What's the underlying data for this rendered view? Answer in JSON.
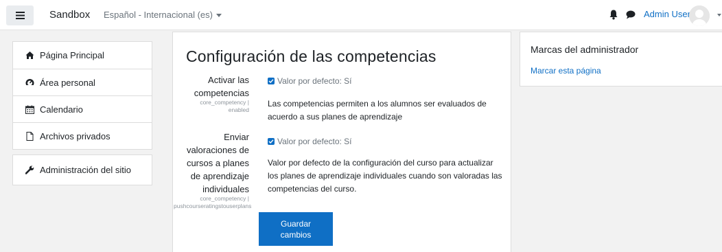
{
  "navbar": {
    "brand": "Sandbox",
    "language": "Español - Internacional (es)",
    "user_name": "Admin User"
  },
  "leftnav": {
    "items": [
      {
        "label": "Página Principal",
        "icon": "home-icon"
      },
      {
        "label": "Área personal",
        "icon": "dashboard-icon"
      },
      {
        "label": "Calendario",
        "icon": "calendar-icon"
      },
      {
        "label": "Archivos privados",
        "icon": "file-icon"
      }
    ],
    "admin": {
      "label": "Administración del sitio",
      "icon": "wrench-icon"
    }
  },
  "main": {
    "title": "Configuración de las competencias",
    "settings": [
      {
        "label": "Activar las competencias",
        "name": "core_competency | enabled",
        "default": "Valor por defecto: Sí",
        "checked": true,
        "description": "Las competencias permiten a los alumnos ser evaluados de acuerdo a sus planes de aprendizaje"
      },
      {
        "label": "Enviar valoraciones de cursos a planes de aprendizaje individuales",
        "name": "core_competency | pushcourseratingstouserplans",
        "default": "Valor por defecto: Sí",
        "checked": true,
        "description": "Valor por defecto de la configuración del curso para actualizar los planes de aprendizaje individuales cuando son valoradas las competencias del curso."
      }
    ],
    "save_label": "Guardar cambios"
  },
  "block": {
    "title": "Marcas del administrador",
    "link": "Marcar esta página"
  },
  "colors": {
    "accent": "#0f6fc5",
    "page_bg": "#f2f2f2"
  }
}
